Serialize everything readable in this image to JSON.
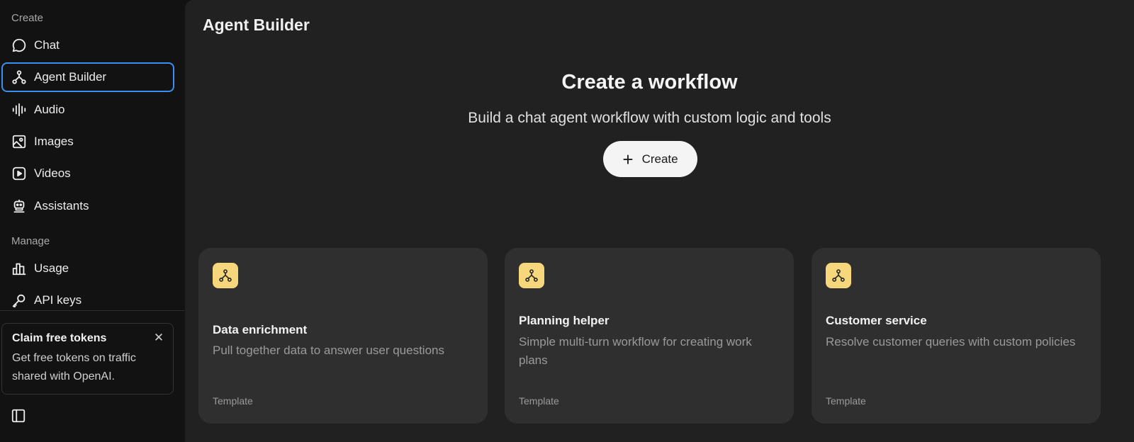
{
  "sidebar": {
    "create_label": "Create",
    "manage_label": "Manage",
    "create_items": [
      {
        "label": "Chat",
        "icon": "chat-bubble-icon"
      },
      {
        "label": "Agent Builder",
        "icon": "agent-builder-icon",
        "active": true
      },
      {
        "label": "Audio",
        "icon": "audio-wave-icon"
      },
      {
        "label": "Images",
        "icon": "image-icon"
      },
      {
        "label": "Videos",
        "icon": "video-play-icon"
      },
      {
        "label": "Assistants",
        "icon": "robot-icon"
      }
    ],
    "manage_items": [
      {
        "label": "Usage",
        "icon": "bar-chart-icon"
      },
      {
        "label": "API keys",
        "icon": "key-icon"
      }
    ],
    "promo": {
      "title": "Claim free tokens",
      "body": "Get free tokens on traffic shared with OpenAI."
    }
  },
  "main": {
    "page_title": "Agent Builder",
    "hero_title": "Create a workflow",
    "hero_subtitle": "Build a chat agent workflow with custom logic and tools",
    "create_button": "Create",
    "cards": [
      {
        "title": "Data enrichment",
        "description": "Pull together data to answer user questions",
        "tag": "Template"
      },
      {
        "title": "Planning helper",
        "description": "Simple multi-turn workflow for creating work plans",
        "tag": "Template"
      },
      {
        "title": "Customer service",
        "description": "Resolve customer queries with custom policies",
        "tag": "Template"
      }
    ]
  },
  "colors": {
    "active_border": "#3b8ff2",
    "card_icon_bg": "#f6d77b",
    "main_bg": "#212121",
    "sidebar_bg": "#121212"
  }
}
